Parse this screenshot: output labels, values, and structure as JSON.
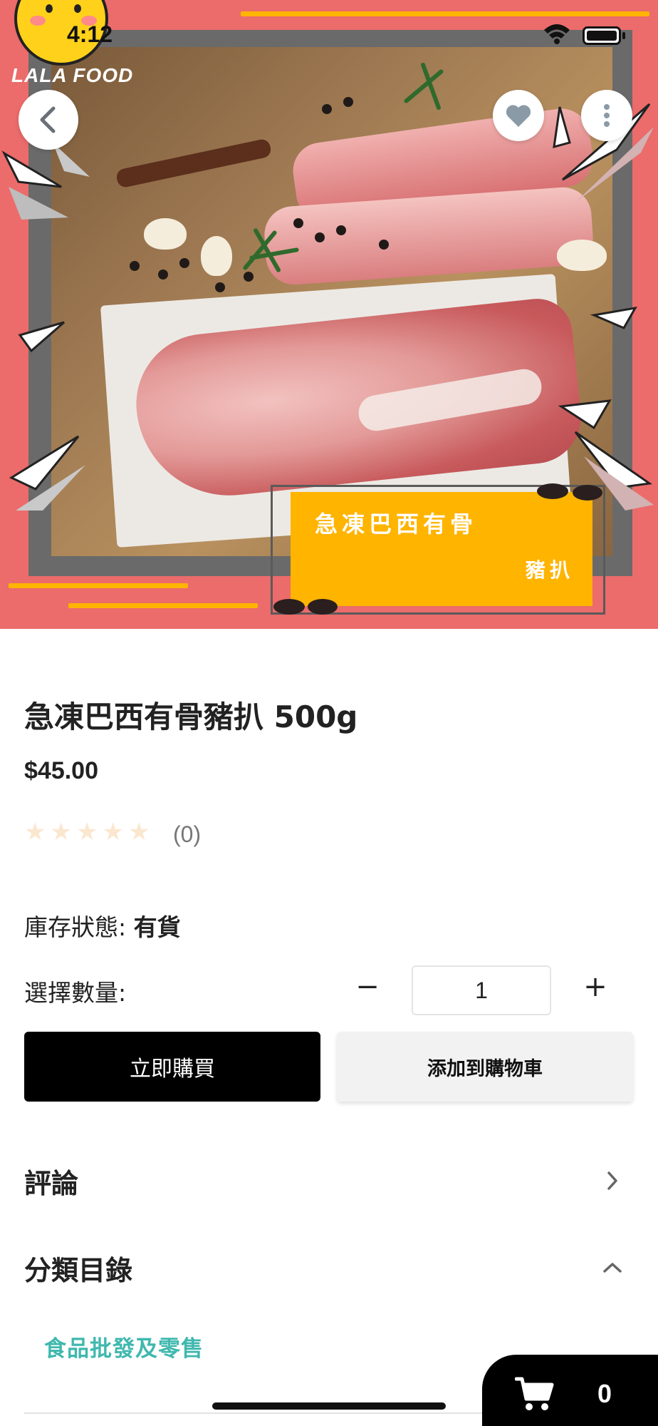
{
  "status_bar": {
    "time": "4:12"
  },
  "brand": {
    "logo_text": "LALA FOOD"
  },
  "hero": {
    "tag_line1": "急凍巴西有骨",
    "tag_line2": "豬扒",
    "colors": {
      "background": "#ec6b6b",
      "accent": "#ffb400",
      "frame": "#6a6a6a"
    }
  },
  "top_actions": {
    "back_icon": "chevron-left-icon",
    "favorite_icon": "heart-icon",
    "more_icon": "more-vertical-icon"
  },
  "product": {
    "title": "急凍巴西有骨豬扒 500g",
    "price": "$45.00",
    "rating": {
      "stars": 0,
      "max_stars": 5,
      "count": "(0)"
    },
    "stock_label": "庫存狀態:",
    "stock_value": "有貨",
    "quantity_label": "選擇數量:",
    "quantity": "1",
    "minus": "−",
    "plus": "+"
  },
  "actions": {
    "buy_now": "立即購買",
    "add_to_cart": "添加到購物車"
  },
  "sections": {
    "reviews": {
      "label": "評論",
      "icon": "chevron-right-icon"
    },
    "categories": {
      "label": "分類目錄",
      "icon": "chevron-up-icon",
      "items": [
        "食品批發及零售"
      ]
    }
  },
  "cart": {
    "count": "0",
    "icon": "cart-icon"
  }
}
